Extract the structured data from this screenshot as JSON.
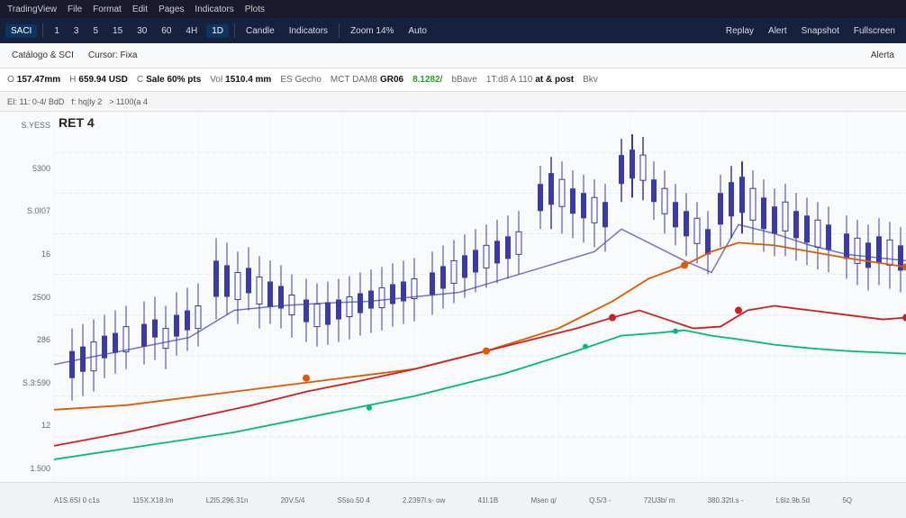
{
  "topMenu": {
    "items": [
      "TradingView",
      "File",
      "Format",
      "Edit",
      "Pages",
      "Indicators",
      "Plots"
    ]
  },
  "toolbar": {
    "symbol": "SACI",
    "timeframes": [
      "1",
      "3",
      "5",
      "15",
      "30",
      "60",
      "4H",
      "1D"
    ],
    "activeTimeframe": "1D",
    "chartType": "Candle",
    "indicators": "Indicators",
    "zoom": "Zoom 14%",
    "autoScale": "Auto",
    "more": "...",
    "replay": "Replay",
    "alert": "Alert",
    "snapshot": "Snapshot",
    "fullscreen": "Fullscreen"
  },
  "subToolbar": {
    "label": "Catálogo & SCI",
    "items": [
      "Cursor: Fixa",
      "Alerta"
    ]
  },
  "dataRow": {
    "fields": [
      {
        "label": "O",
        "value": "157.47mm",
        "color": "normal"
      },
      {
        "label": "H",
        "value": "659.94 USD",
        "color": "normal"
      },
      {
        "label": "C",
        "value": "Sale 60% pts",
        "color": "normal"
      },
      {
        "label": "Vol",
        "value": "1510.4 mm",
        "color": "normal"
      },
      {
        "label": "ES Gecho",
        "value": "",
        "color": "normal"
      },
      {
        "label": "MCT DAM8",
        "value": "GR06",
        "color": "normal"
      },
      {
        "label": "8.1282/",
        "value": "",
        "color": "normal"
      },
      {
        "label": "bBave",
        "value": "",
        "color": "normal"
      },
      {
        "label": "1T:d8 A 110",
        "value": "at & post",
        "color": "normal"
      },
      {
        "label": "Bkv",
        "value": "",
        "color": "normal"
      }
    ]
  },
  "indicatorRow": {
    "items": [
      "EI: 11: 0-4/ BdD",
      "f: hq|ly 2",
      "> 1100(a 4"
    ]
  },
  "chart": {
    "title": "RET 4",
    "yLabels": [
      "S.YESS",
      "5300",
      "S.0I07",
      "16",
      "2500",
      "286",
      "S.3:590",
      "12",
      "1.500"
    ],
    "xLabels": [
      "A1S.6SI 0 c1s",
      "115X.X18.Im",
      "L2I5.296.31n",
      "20V.5/4",
      "S5so.50 4",
      "2.2397l.s- ow",
      "41l.1B",
      "Msen q/",
      "Q.5/3 -",
      "72U3b/ m",
      "380.32tI.s -",
      "L6Iz.9b.5d",
      "5Q"
    ],
    "colors": {
      "candles": "#3a3aaa",
      "line1": "#e05a00",
      "line2": "#cc2222",
      "line3": "#00bb77",
      "line4": "#3a3aaa"
    }
  }
}
